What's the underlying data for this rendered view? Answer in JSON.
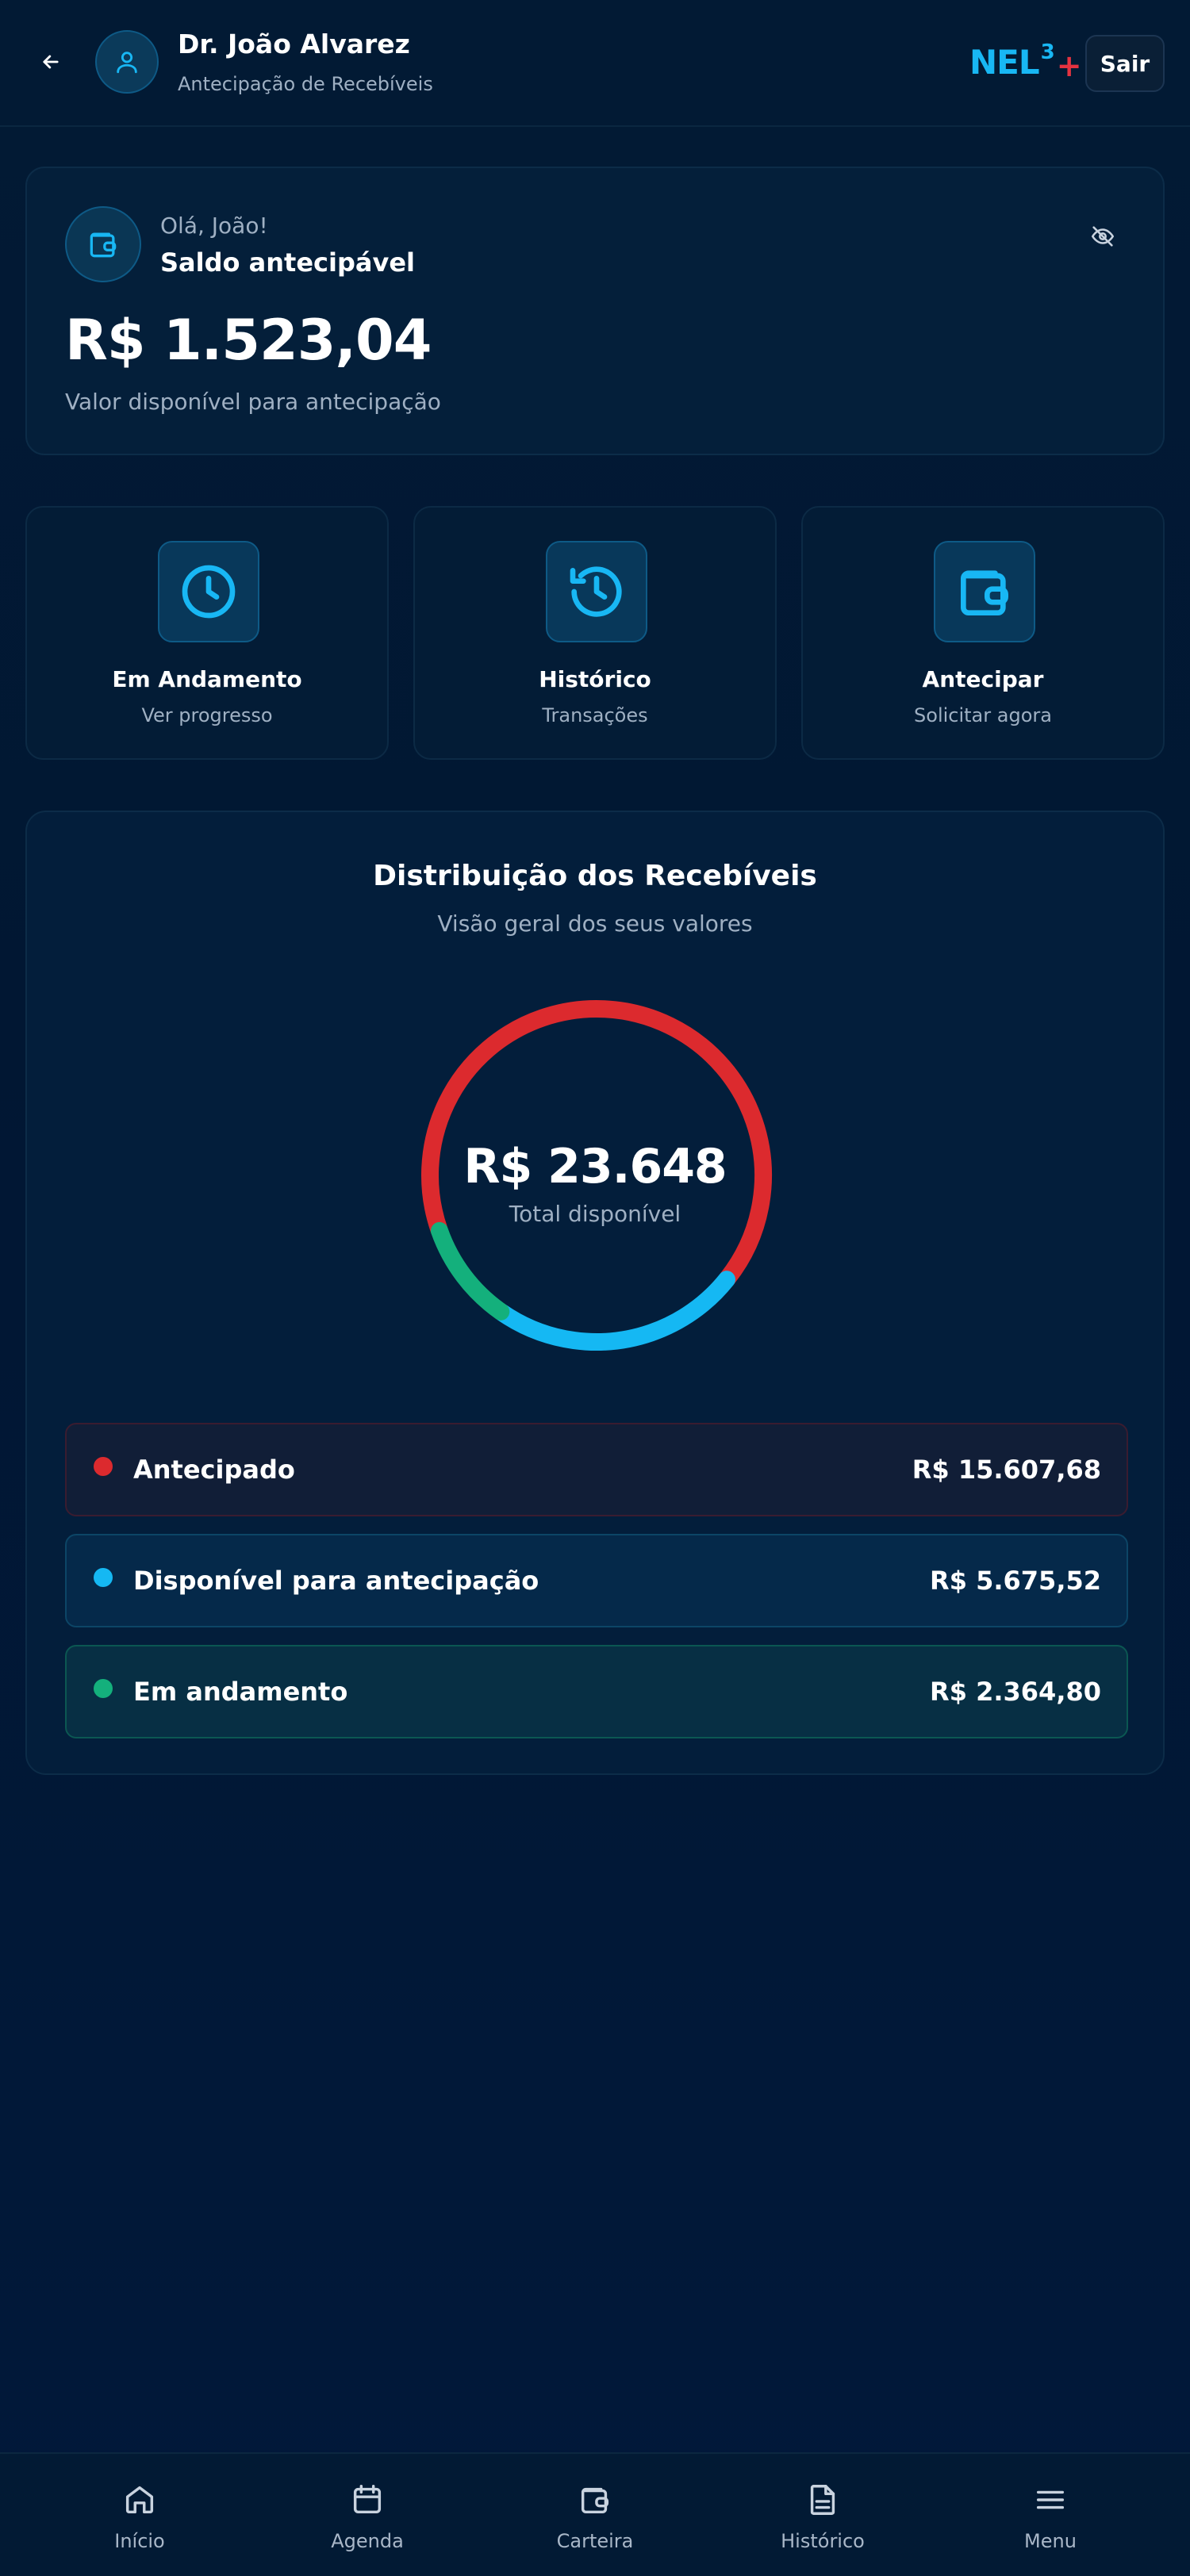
{
  "header": {
    "user_name": "Dr. João Alvarez",
    "user_subtitle": "Antecipação de Recebíveis",
    "logo_text": "NEL",
    "logo_sup": "3",
    "logo_plus": "+",
    "logout_label": "Sair"
  },
  "balance": {
    "greeting": "Olá, João!",
    "label": "Saldo antecipável",
    "value": "R$ 1.523,04",
    "caption": "Valor disponível para antecipação"
  },
  "actions": [
    {
      "title": "Em Andamento",
      "subtitle": "Ver progresso",
      "icon": "clock-icon"
    },
    {
      "title": "Histórico",
      "subtitle": "Transações",
      "icon": "history-icon"
    },
    {
      "title": "Antecipar",
      "subtitle": "Solicitar agora",
      "icon": "wallet-icon"
    }
  ],
  "distribution": {
    "title": "Distribuição dos Recebíveis",
    "subtitle": "Visão geral dos seus valores",
    "total_value": "R$ 23.648",
    "total_caption": "Total disponível",
    "legend": [
      {
        "label": "Antecipado",
        "value": "R$ 15.607,68",
        "color": "#dc2a2e"
      },
      {
        "label": "Disponível para antecipação",
        "value": "R$ 5.675,52",
        "color": "#15b8f3"
      },
      {
        "label": "Em andamento",
        "value": "R$ 2.364,80",
        "color": "#14b07c"
      }
    ]
  },
  "chart_data": {
    "type": "pie",
    "categories": [
      "Antecipado",
      "Disponível para antecipação",
      "Em andamento"
    ],
    "values": [
      15607.68,
      5675.52,
      2364.8
    ],
    "colors": [
      "#dc2a2e",
      "#15b8f3",
      "#14b07c"
    ],
    "title": "Distribuição dos Recebíveis"
  },
  "nav": [
    {
      "label": "Início",
      "icon": "home-icon"
    },
    {
      "label": "Agenda",
      "icon": "calendar-icon"
    },
    {
      "label": "Carteira",
      "icon": "wallet-icon"
    },
    {
      "label": "Histórico",
      "icon": "document-icon"
    },
    {
      "label": "Menu",
      "icon": "menu-icon"
    }
  ],
  "colors": {
    "accent": "#18b7f4",
    "background": "#011733",
    "card": "#041f3a",
    "logo_plus": "#e53340"
  }
}
